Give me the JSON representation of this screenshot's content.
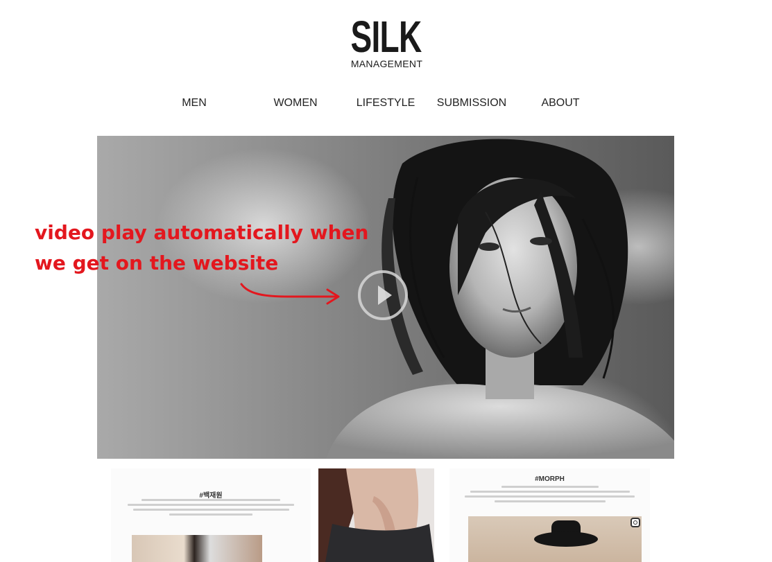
{
  "logo": {
    "title": "SILK",
    "subtitle": "MANAGEMENT"
  },
  "nav": {
    "items": [
      {
        "label": "MEN"
      },
      {
        "label": "WOMEN"
      },
      {
        "label": "LIFESTYLE"
      },
      {
        "label": "SUBMISSION"
      },
      {
        "label": "ABOUT"
      }
    ]
  },
  "hero": {
    "play_icon": "play-circle-icon"
  },
  "annotation": {
    "lines": [
      "video play automatically when",
      "we get on the website"
    ],
    "color": "#e3171e"
  },
  "strip": {
    "card1": {
      "tag": "#백재원"
    },
    "card3": {
      "tag": "#MORPH",
      "icon": "instagram-icon"
    }
  },
  "colors": {
    "text": "#222222",
    "annotation": "#e3171e",
    "background": "#ffffff"
  }
}
